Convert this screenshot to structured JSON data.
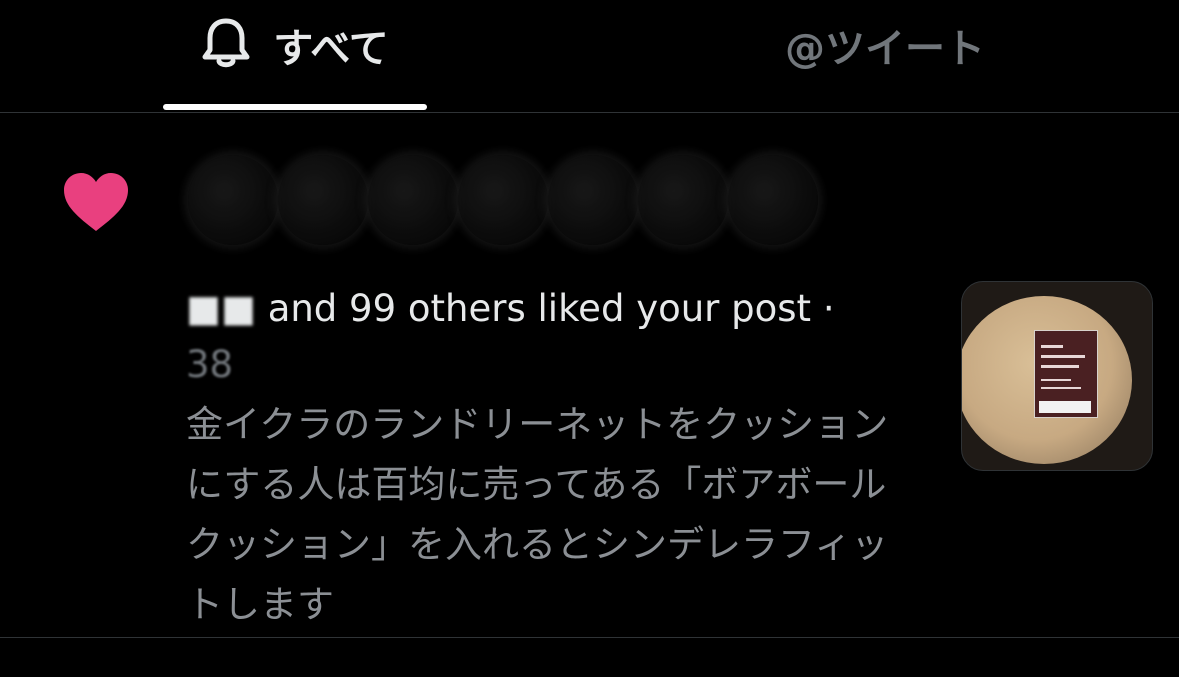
{
  "tabs": {
    "all_label": "すべて",
    "mentions_label": "@ツイート",
    "bell_icon": "bell-icon"
  },
  "notification": {
    "icon": "heart-icon",
    "icon_color": "#e9407f",
    "likers_text": "and 99 others liked your post ·",
    "time_text": "38",
    "post_text": "金イクラのランドリーネットをクッションにする人は百均に売ってある「ボアボールクッション」を入れるとシンデレラフィットします"
  },
  "colors": {
    "background": "#000000",
    "active_text": "#e7e9ea",
    "muted_text": "#71767b",
    "divider": "#2f3336"
  }
}
